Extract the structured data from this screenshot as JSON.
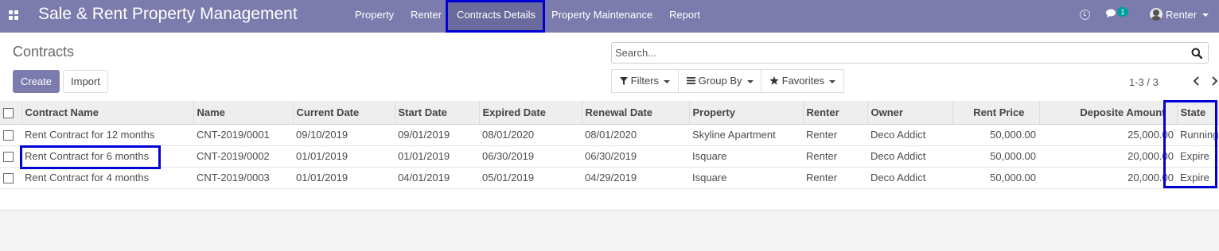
{
  "navbar": {
    "app_title": "Sale & Rent Property Management",
    "menu": [
      {
        "label": "Property"
      },
      {
        "label": "Renter"
      },
      {
        "label": "Contracts Details"
      },
      {
        "label": "Property Maintenance"
      },
      {
        "label": "Report"
      }
    ],
    "message_count": "1",
    "user_name": "Renter",
    "colors": {
      "bar": "#7c7bad",
      "active_item": "#6b6a9d",
      "badge": "#00a09d"
    }
  },
  "control_panel": {
    "breadcrumb": "Contracts",
    "create_label": "Create",
    "import_label": "Import",
    "search_placeholder": "Search...",
    "filters_label": "Filters",
    "group_by_label": "Group By",
    "favorites_label": "Favorites",
    "pager": "1-3 / 3"
  },
  "table": {
    "columns": [
      "Contract Name",
      "Name",
      "Current Date",
      "Start Date",
      "Expired Date",
      "Renewal Date",
      "Property",
      "Renter",
      "Owner",
      "Rent Price",
      "Deposite Amount",
      "State"
    ],
    "rows": [
      [
        "Rent Contract for 12 months",
        "CNT-2019/0001",
        "09/10/2019",
        "09/01/2019",
        "08/01/2020",
        "08/01/2020",
        "Skyline Apartment",
        "Renter",
        "Deco Addict",
        "50,000.00",
        "25,000.00",
        "Running"
      ],
      [
        "Rent Contract for 6 months",
        "CNT-2019/0002",
        "01/01/2019",
        "01/01/2019",
        "06/30/2019",
        "06/30/2019",
        "Isquare",
        "Renter",
        "Deco Addict",
        "50,000.00",
        "20,000.00",
        "Expire"
      ],
      [
        "Rent Contract for 4 months",
        "CNT-2019/0003",
        "01/01/2019",
        "04/01/2019",
        "05/01/2019",
        "04/29/2019",
        "Isquare",
        "Renter",
        "Deco Addict",
        "50,000.00",
        "20,000.00",
        "Expire"
      ]
    ]
  },
  "annotation_color": "#0000d6"
}
